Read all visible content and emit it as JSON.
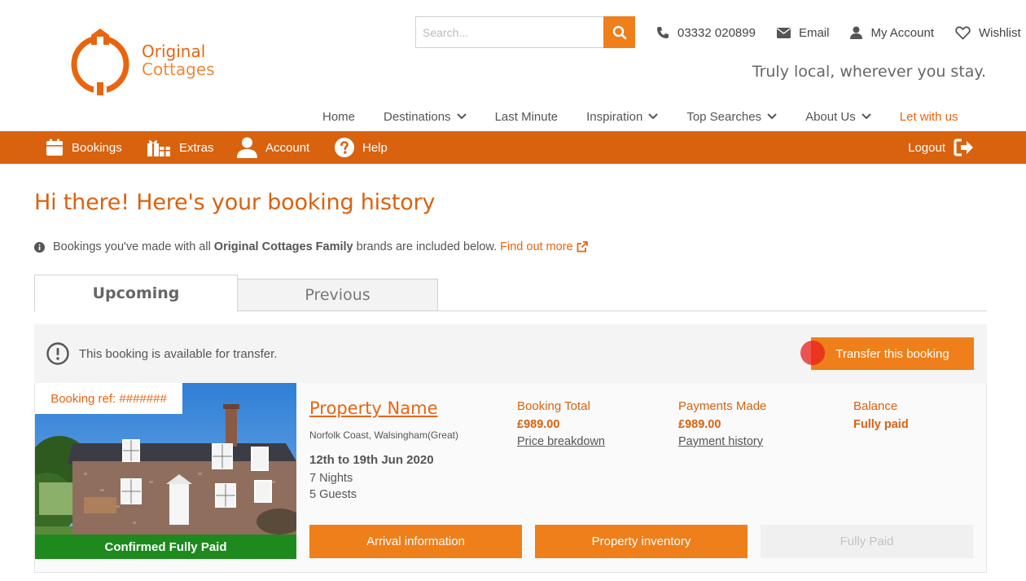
{
  "brand": {
    "line1": "Original",
    "line2": "Cottages",
    "accent_color": "#d9620f",
    "button_color": "#ef7f1a"
  },
  "search": {
    "placeholder": "Search..."
  },
  "top_links": {
    "phone": "03332 020899",
    "email": "Email",
    "account": "My Account",
    "wishlist": "Wishlist"
  },
  "tagline": "Truly local, wherever you stay.",
  "main_nav": {
    "home": "Home",
    "destinations": "Destinations",
    "last_minute": "Last Minute",
    "inspiration": "Inspiration",
    "top_searches": "Top Searches",
    "about_us": "About Us",
    "let_with_us": "Let with us"
  },
  "account_bar": {
    "bookings": "Bookings",
    "extras": "Extras",
    "account": "Account",
    "help": "Help",
    "logout": "Logout"
  },
  "page": {
    "title": "Hi there! Here's your booking history",
    "info_prefix": "Bookings you've made with all",
    "info_brand": "Original Cottages Family",
    "info_suffix": "brands are included below.",
    "info_link": "Find out more"
  },
  "tabs": {
    "upcoming": "Upcoming",
    "previous": "Previous"
  },
  "transfer": {
    "message": "This booking is available for transfer.",
    "button": "Transfer this booking"
  },
  "booking": {
    "ref": "Booking ref: #######",
    "status": "Confirmed Fully Paid",
    "property_name": "Property Name",
    "location": "Norfolk Coast, Walsingham(Great)",
    "dates": "12th to 19th Jun 2020",
    "nights": "7 Nights",
    "guests": "5 Guests",
    "total_label": "Booking Total",
    "total_value": "£989.00",
    "total_link": "Price breakdown",
    "payments_label": "Payments Made",
    "payments_value": "£989.00",
    "payments_link": "Payment history",
    "balance_label": "Balance",
    "balance_value": "Fully paid",
    "btn_arrival": "Arrival information",
    "btn_inventory": "Property inventory",
    "btn_paid": "Fully Paid"
  }
}
